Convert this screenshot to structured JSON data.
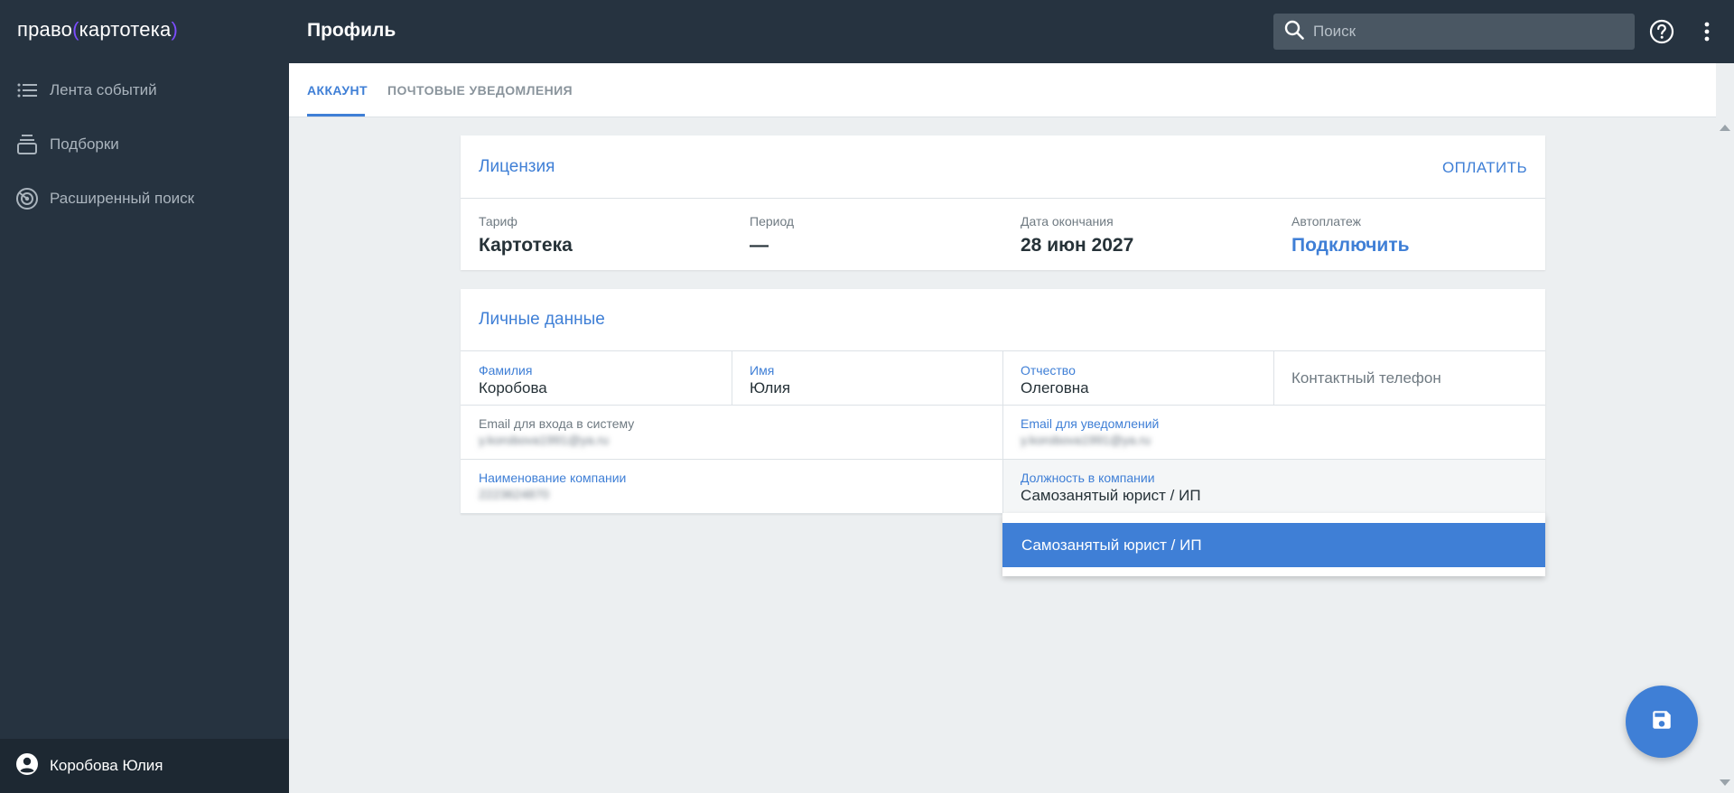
{
  "app": {
    "logo_left": "право",
    "logo_bracket_open": "(",
    "logo_middle": "картотека",
    "logo_bracket_close": ")"
  },
  "sidebar": {
    "items": [
      {
        "label": "Лента событий",
        "icon": "list-icon"
      },
      {
        "label": "Подборки",
        "icon": "stack-icon"
      },
      {
        "label": "Расширенный поиск",
        "icon": "radar-icon"
      }
    ],
    "user": {
      "name": "Коробова Юлия",
      "icon": "account-circle-icon"
    }
  },
  "header": {
    "title": "Профиль",
    "search_placeholder": "Поиск",
    "search_value": ""
  },
  "tabs": [
    {
      "label": "АККАУНТ",
      "active": true
    },
    {
      "label": "ПОЧТОВЫЕ УВЕДОМЛЕНИЯ",
      "active": false
    }
  ],
  "license": {
    "title": "Лицензия",
    "pay_label": "ОПЛАТИТЬ",
    "tariff_label": "Тариф",
    "tariff_value": "Картотека",
    "period_label": "Период",
    "period_value": "—",
    "end_label": "Дата окончания",
    "end_value": "28 июн 2027",
    "autopay_label": "Автоплатеж",
    "autopay_value": "Подключить"
  },
  "personal": {
    "title": "Личные данные",
    "last_name_label": "Фамилия",
    "last_name_value": "Коробова",
    "first_name_label": "Имя",
    "first_name_value": "Юлия",
    "patronymic_label": "Отчество",
    "patronymic_value": "Олеговна",
    "phone_placeholder": "Контактный телефон",
    "login_email_label": "Email для входа в систему",
    "login_email_value": "y.korobova1991@ya.ru",
    "notify_email_label": "Email для уведомлений",
    "notify_email_value": "y.korobova1991@ya.ru",
    "company_label": "Наименование компании",
    "company_value": "2223624870",
    "position_label": "Должность в компании",
    "position_value": "Самозанятый юрист / ИП"
  },
  "dropdown": {
    "options": [
      "Самозанятый юрист / ИП"
    ]
  },
  "colors": {
    "sidebar_bg": "#263340",
    "accent": "#3f7fd6",
    "page_bg": "#eceff1"
  }
}
